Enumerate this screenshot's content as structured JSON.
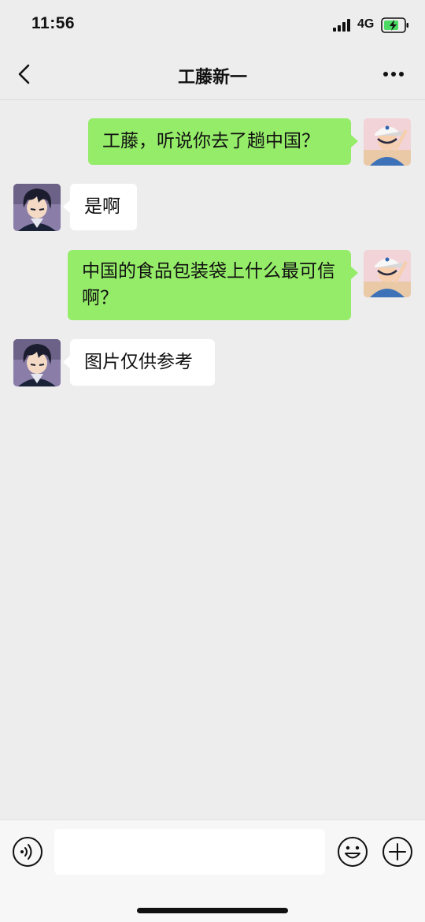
{
  "status_bar": {
    "time": "11:56",
    "network": "4G",
    "icons": [
      "signal-icon",
      "battery-charging-icon"
    ]
  },
  "header": {
    "title": "工藤新一",
    "icons": [
      "back-chevron-icon",
      "more-dots-icon"
    ]
  },
  "messages": [
    {
      "side": "me",
      "text": "工藤，听说你去了趟中国？"
    },
    {
      "side": "contact",
      "text": "是啊"
    },
    {
      "side": "me",
      "text": "中国的食品包装袋上什么最可信啊？"
    },
    {
      "side": "contact",
      "text": "图片仅供参考"
    }
  ],
  "composer": {
    "placeholder": "",
    "value": "",
    "icons": [
      "voice-icon",
      "emoji-icon",
      "plus-icon"
    ]
  },
  "colors": {
    "background": "#ededed",
    "my_bubble": "#95ec69",
    "their_bubble": "#ffffff",
    "battery_charge": "#4cd964"
  }
}
